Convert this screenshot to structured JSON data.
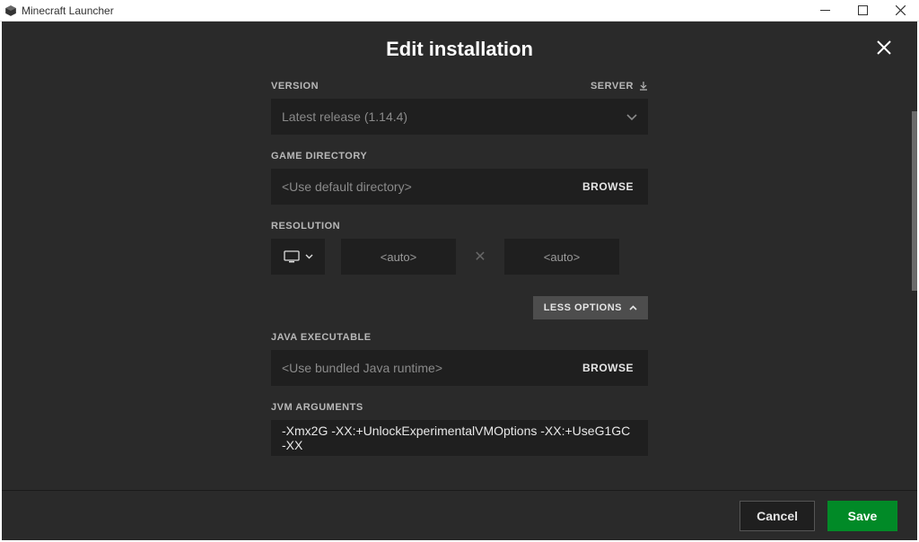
{
  "window": {
    "title": "Minecraft Launcher"
  },
  "dialog": {
    "title": "Edit installation",
    "version": {
      "label": "VERSION",
      "value": "Latest release (1.14.4)",
      "server_label": "SERVER"
    },
    "game_directory": {
      "label": "GAME DIRECTORY",
      "placeholder": "<Use default directory>",
      "browse": "BROWSE"
    },
    "resolution": {
      "label": "RESOLUTION",
      "width": "<auto>",
      "height": "<auto>"
    },
    "less_options": "LESS OPTIONS",
    "java_executable": {
      "label": "JAVA EXECUTABLE",
      "placeholder": "<Use bundled Java runtime>",
      "browse": "BROWSE"
    },
    "jvm_arguments": {
      "label": "JVM ARGUMENTS",
      "value": "-Xmx2G -XX:+UnlockExperimentalVMOptions -XX:+UseG1GC -XX"
    },
    "footer": {
      "cancel": "Cancel",
      "save": "Save"
    }
  }
}
